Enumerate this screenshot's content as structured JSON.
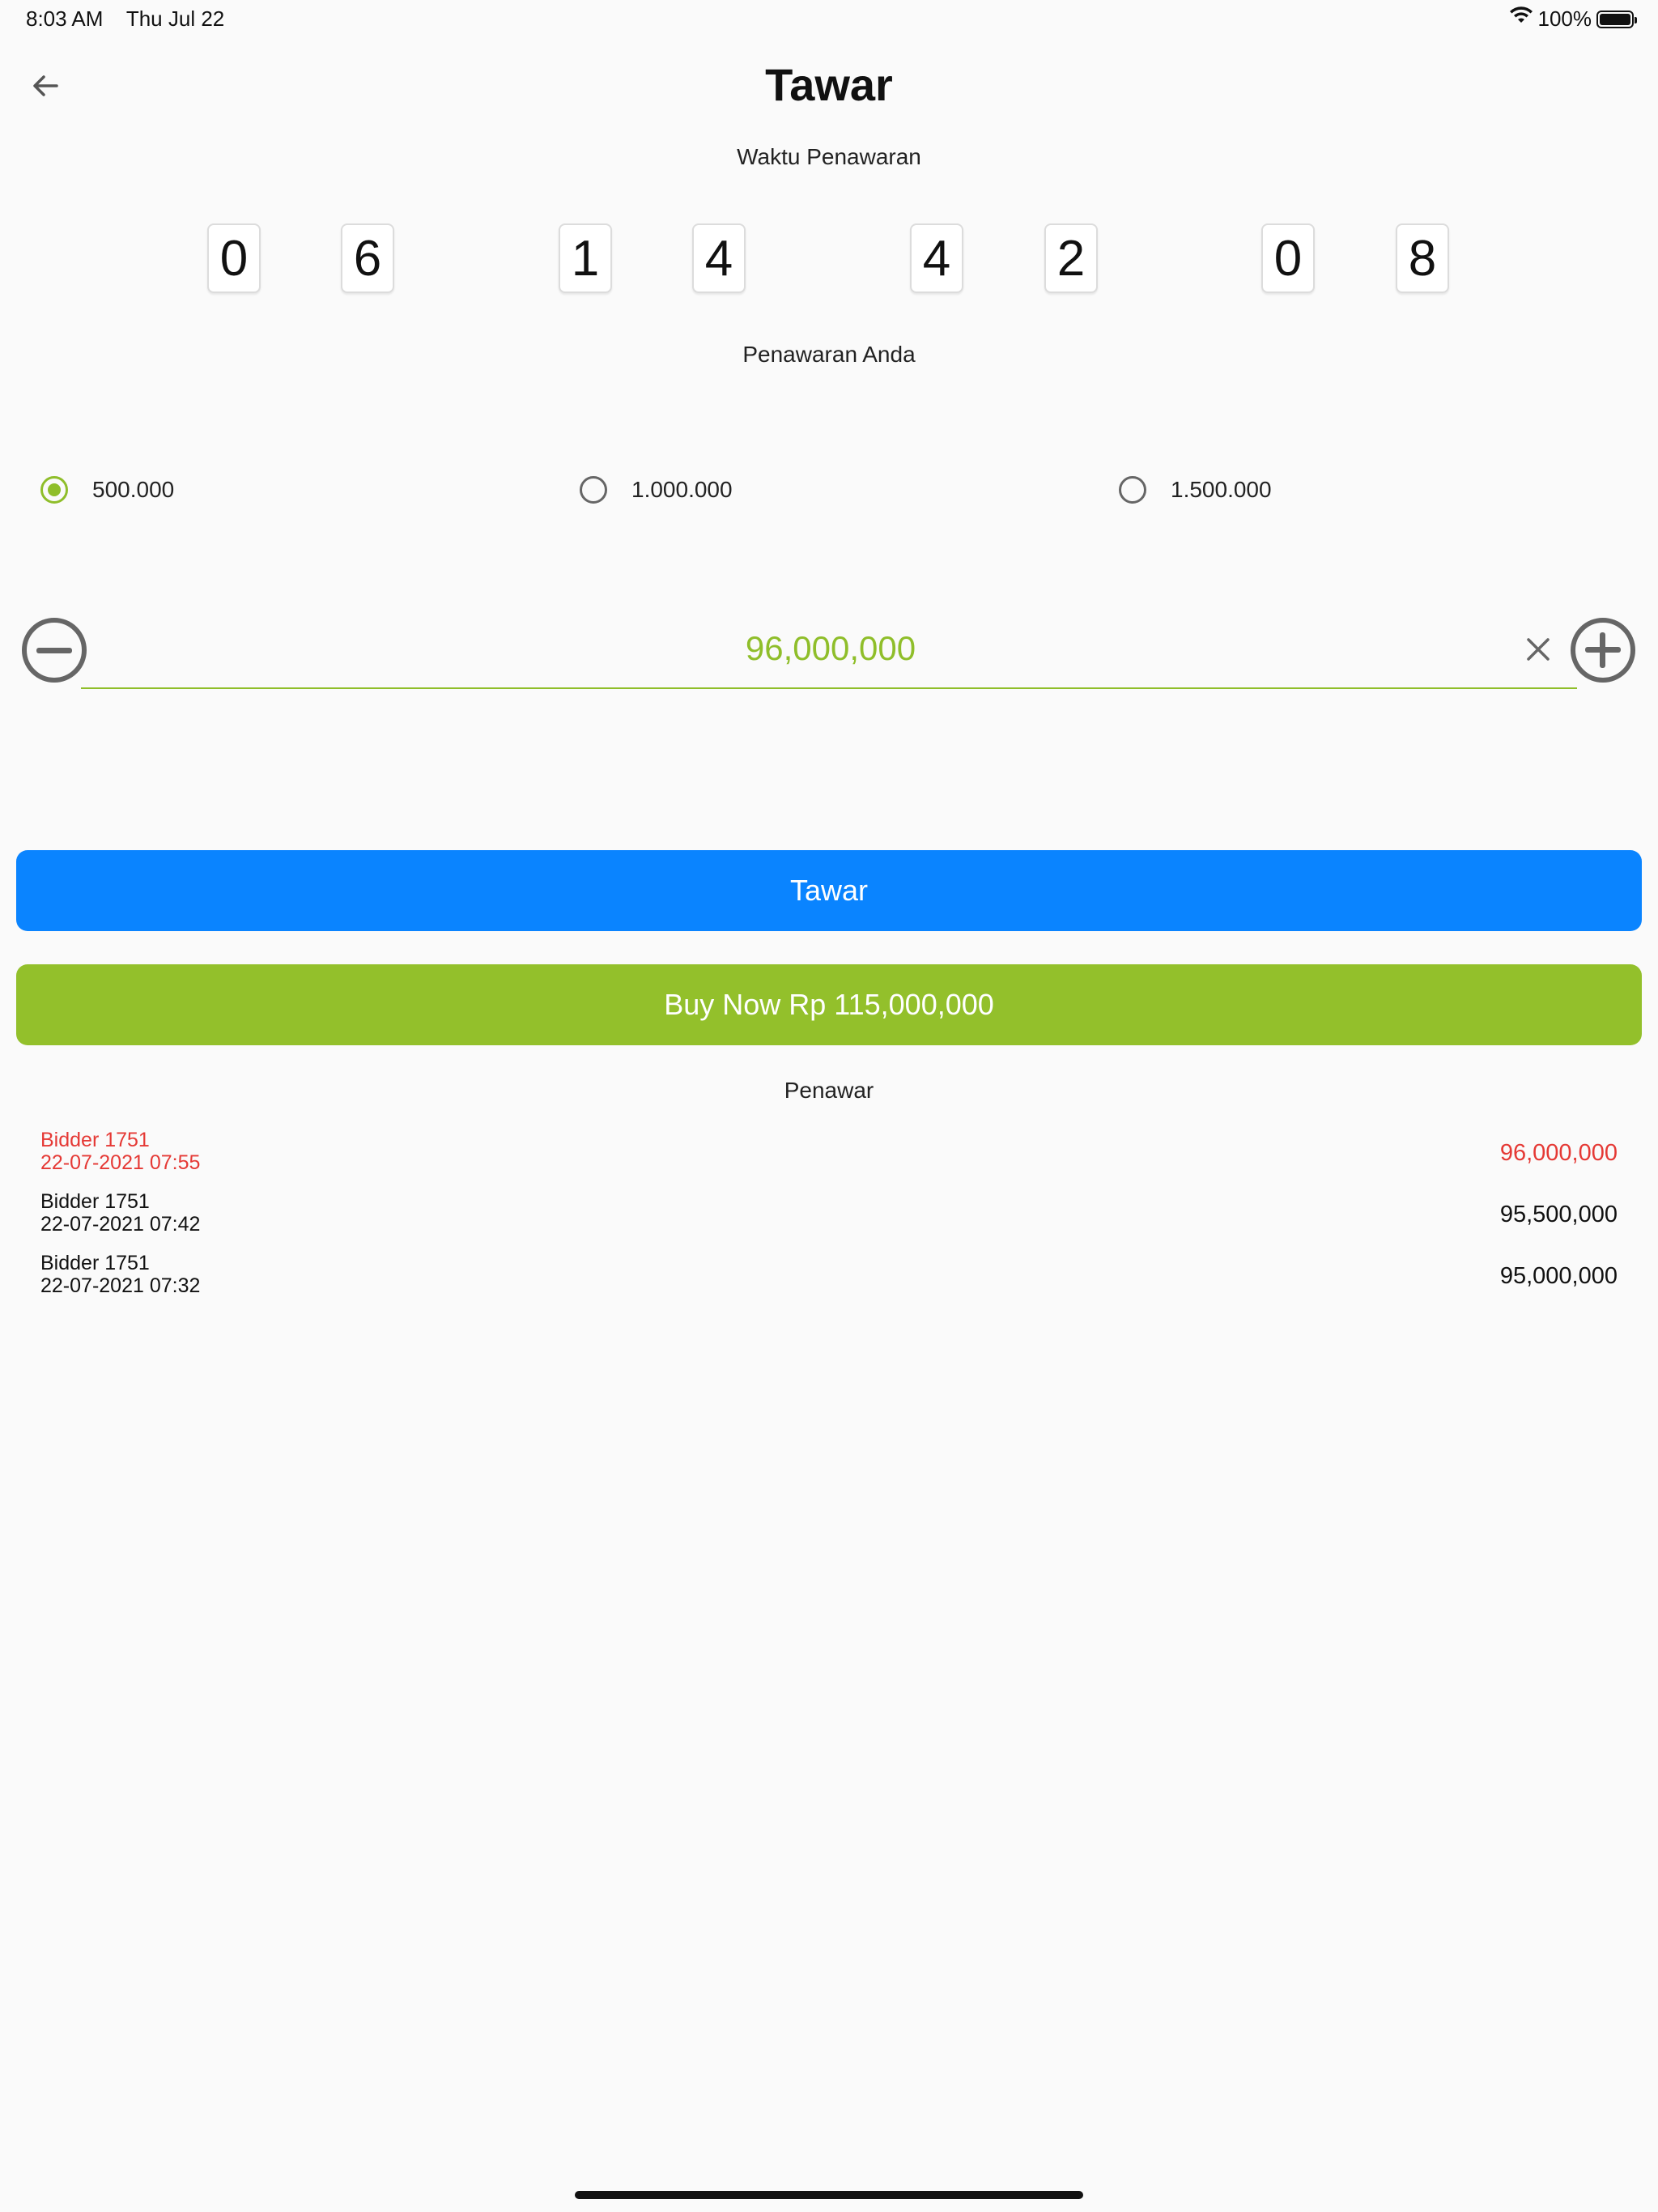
{
  "status_bar": {
    "time": "8:03 AM",
    "date": "Thu Jul 22",
    "battery": "100%",
    "wifi_icon": "wifi-icon",
    "battery_icon": "battery-icon"
  },
  "header": {
    "title": "Tawar",
    "back_icon": "arrow-left-icon"
  },
  "countdown": {
    "label": "Waktu Penawaran",
    "digits": [
      "0",
      "6",
      "1",
      "4",
      "4",
      "2",
      "0",
      "8"
    ]
  },
  "offer": {
    "label": "Penawaran Anda",
    "increments": [
      {
        "label": "500.000",
        "selected": true
      },
      {
        "label": "1.000.000",
        "selected": false
      },
      {
        "label": "1.500.000",
        "selected": false
      }
    ],
    "amount": "96,000,000",
    "minus_icon": "minus-circle-icon",
    "plus_icon": "plus-circle-icon",
    "clear_icon": "close-icon"
  },
  "actions": {
    "bid_label": "Tawar",
    "buy_now_label": "Buy Now Rp 115,000,000"
  },
  "bidders": {
    "label": "Penawar",
    "rows": [
      {
        "name": "Bidder 1751",
        "datetime": "22-07-2021 07:55",
        "amount": "96,000,000",
        "highlight": true
      },
      {
        "name": "Bidder 1751",
        "datetime": "22-07-2021 07:42",
        "amount": "95,500,000",
        "highlight": false
      },
      {
        "name": "Bidder 1751",
        "datetime": "22-07-2021 07:32",
        "amount": "95,000,000",
        "highlight": false
      }
    ]
  },
  "colors": {
    "accent_green": "#93c02b",
    "primary_blue": "#0a84ff",
    "highlight_red": "#e53935"
  }
}
